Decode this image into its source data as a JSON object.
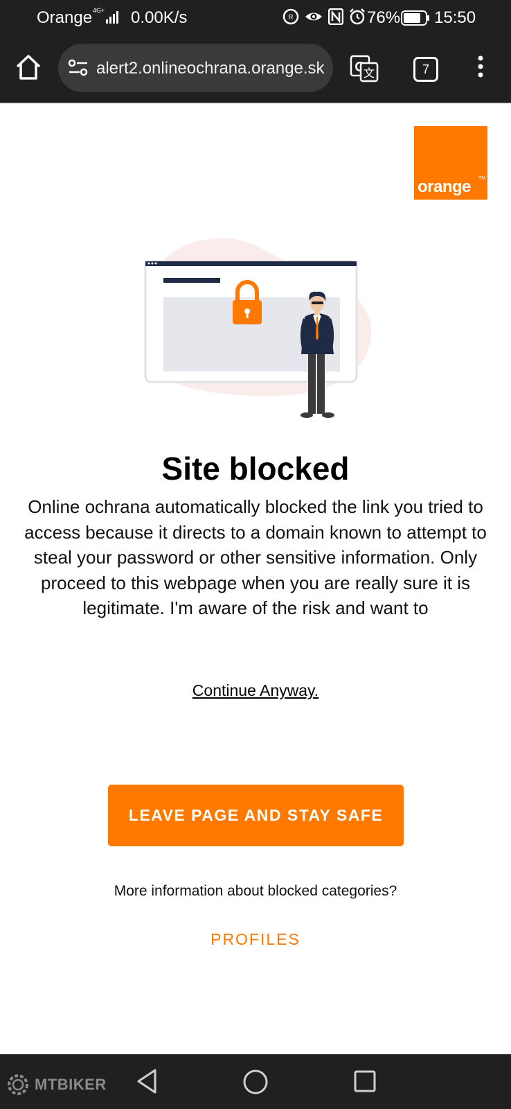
{
  "status_bar": {
    "carrier": "Orange",
    "network_type": "4G+",
    "data_speed": "0.00K/s",
    "battery_percent": "76%",
    "time": "15:50",
    "icons": [
      "nfc-alt-icon",
      "eye-icon",
      "nfc-icon",
      "alarm-icon",
      "battery-icon"
    ]
  },
  "browser": {
    "url": "alert2.onlineochrana.orange.sk",
    "tab_count": "7"
  },
  "page": {
    "logo_text": "orange",
    "logo_tm": "TM",
    "headline": "Site blocked",
    "body": "Online ochrana automatically blocked the link you tried to access because it directs to a domain known to attempt to steal your password or other sensitive information. Only proceed to this webpage when you are really sure it is legitimate. I'm aware of the risk and want to",
    "continue_link": "Continue Anyway.",
    "leave_button": "LEAVE PAGE AND STAY SAFE",
    "more_info": "More information about blocked categories?",
    "profiles_link": "PROFILES"
  },
  "watermark": "MTBIKER",
  "colors": {
    "brand_orange": "#ff7900",
    "system_bar": "#202020",
    "url_bar": "#3a3a3a"
  }
}
